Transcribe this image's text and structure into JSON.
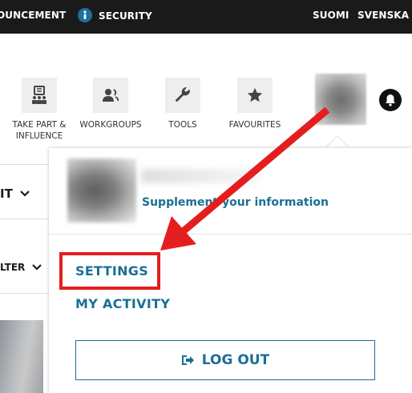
{
  "topbar": {
    "announcement": "OUNCEMENT",
    "security": "SECURITY",
    "lang_fi": "SUOMI",
    "lang_sv": "SVENSKA"
  },
  "nav": {
    "take_part_line1": "TAKE PART &",
    "take_part_line2": "INFLUENCE",
    "workgroups": "WORKGROUPS",
    "tools": "TOOLS",
    "favourites": "FAVOURITES"
  },
  "left": {
    "it": "IT",
    "lter": "LTER"
  },
  "dropdown": {
    "supplement": "Supplement your information",
    "settings": "SETTINGS",
    "my_activity": "MY ACTIVITY",
    "logout": "LOG OUT"
  },
  "colors": {
    "accent": "#1b6f94",
    "annotation": "#e41e1e",
    "topbar": "#1a1a1a"
  },
  "icons": [
    "info-shield-icon",
    "take-part-icon",
    "workgroups-icon",
    "wrench-icon",
    "star-icon",
    "bell-icon",
    "chevron-down-icon",
    "logout-icon",
    "red-arrow"
  ]
}
